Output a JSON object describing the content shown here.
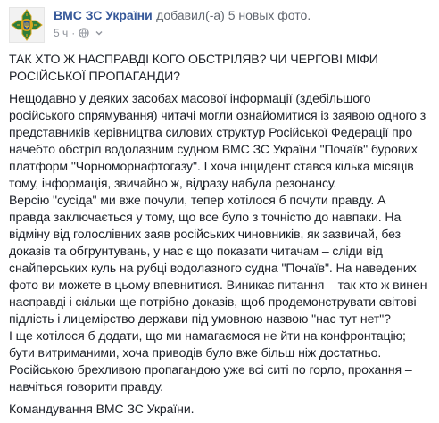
{
  "post": {
    "author": "ВМС ЗС України",
    "action": "добавил(-а) 5 новых фото.",
    "time": "5 ч",
    "title_lines": [
      "ТАК ХТО Ж НАСПРАВДІ КОГО ОБСТРІЛЯВ? ЧИ ЧЕРГОВІ МІФИ",
      "РОСІЙСЬКОЇ ПРОПАГАНДИ?"
    ],
    "body_lines": [
      "Нещодавно у деяких засобах масової інформації (здебільшого",
      "російського спрямування) читачі могли ознайомитися із заявою одного з",
      "представників керівництва силових структур Російської Федерації про",
      "начебто обстріл водолазним судном ВМС ЗС України \"Почаїв\" бурових",
      "платформ \"Чорноморнафтогазу\". І хоча інцидент стався кілька місяців",
      "тому, інформація, звичайно ж, відразу набула резонансу.",
      "Версію \"сусіда\" ми вже почули, тепер хотілося б почути правду. А",
      "правда заключається у тому, що все було з точністю до навпаки. На",
      "відміну від голослівних заяв російських чиновників, як зазвичай, без",
      "доказів та обгрунтувань, у нас є що показати читачам – сліди від",
      "снайперських куль на рубці водолазного судна \"Почаїв\". На наведених",
      "фото ви можете в цьому впевнитися. Виникає питання – так хто ж винен",
      "насправді і скільки ще потрібно доказів, щоб продемонструвати світові",
      "підлість і лицемірство держави під умовною назвою \"нас тут нет\"?",
      "І ще хотілося б додати, що ми намагаємося не йти на конфронтацію;",
      "бути витриманими, хоча приводів було вже більш ніж достатньо.",
      "Російською брехливою пропагандою уже всі ситі по горло, прохання –",
      "навчіться говорити правду."
    ],
    "signature": "Командування ВМС ЗС України."
  },
  "icons": {
    "avatar": "navy-emblem-icon",
    "audience": "globe-icon",
    "dropdown": "chevron-down-icon"
  },
  "colors": {
    "author_link": "#365899",
    "text": "#1d2129",
    "meta": "#90949c",
    "emblem_green": "#2e7d3a",
    "emblem_gold": "#d9a61e"
  }
}
